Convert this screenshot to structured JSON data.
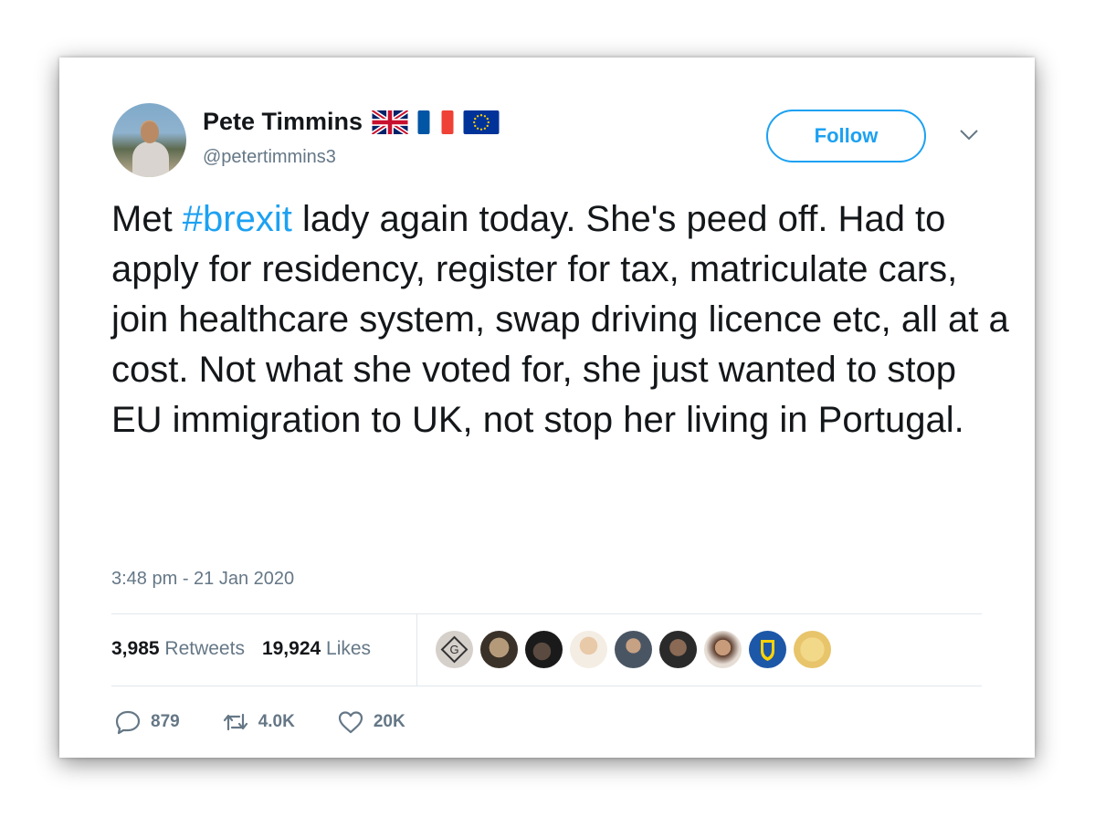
{
  "author": {
    "name": "Pete Timmins",
    "handle": "@petertimmins3",
    "flags": [
      "uk-flag",
      "france-flag",
      "eu-flag"
    ]
  },
  "follow_label": "Follow",
  "tweet": {
    "part1": "Met ",
    "hashtag": "#brexit",
    "part2": " lady again today. She's peed off. Had to apply for residency, register for tax, matriculate cars, join healthcare system, swap driving licence etc, all at a cost. Not what she voted for, she just wanted to stop EU immigration to UK, not stop her living in Portugal."
  },
  "timestamp": "3:48 pm - 21 Jan 2020",
  "stats": {
    "retweets_count": "3,985",
    "retweets_label": "Retweets",
    "likes_count": "19,924",
    "likes_label": "Likes"
  },
  "liker_avatars": [
    "liker-1",
    "liker-2",
    "liker-3",
    "liker-4",
    "liker-5",
    "liker-6",
    "liker-7",
    "liker-8",
    "liker-9"
  ],
  "actions": {
    "replies": "879",
    "retweets": "4.0K",
    "likes": "20K"
  },
  "colors": {
    "accent": "#1da1f2",
    "text": "#14171a",
    "secondary": "#657786"
  }
}
